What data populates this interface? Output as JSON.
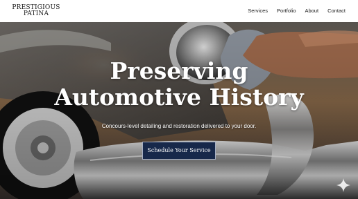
{
  "brand": {
    "line1": "PRESTIGIOUS",
    "line2": "PATINA"
  },
  "nav": {
    "items": [
      "Services",
      "Portfolio",
      "About",
      "Contact"
    ]
  },
  "hero": {
    "headline_line1": "Preserving",
    "headline_line2": "Automotive History",
    "subtext": "Concours-level detailing and restoration delivered to your door.",
    "cta_label": "Schedule Your Service"
  },
  "colors": {
    "cta_background": "#17284a",
    "header_background": "#ffffff"
  },
  "icons": {
    "sparkle": "sparkle-icon"
  }
}
